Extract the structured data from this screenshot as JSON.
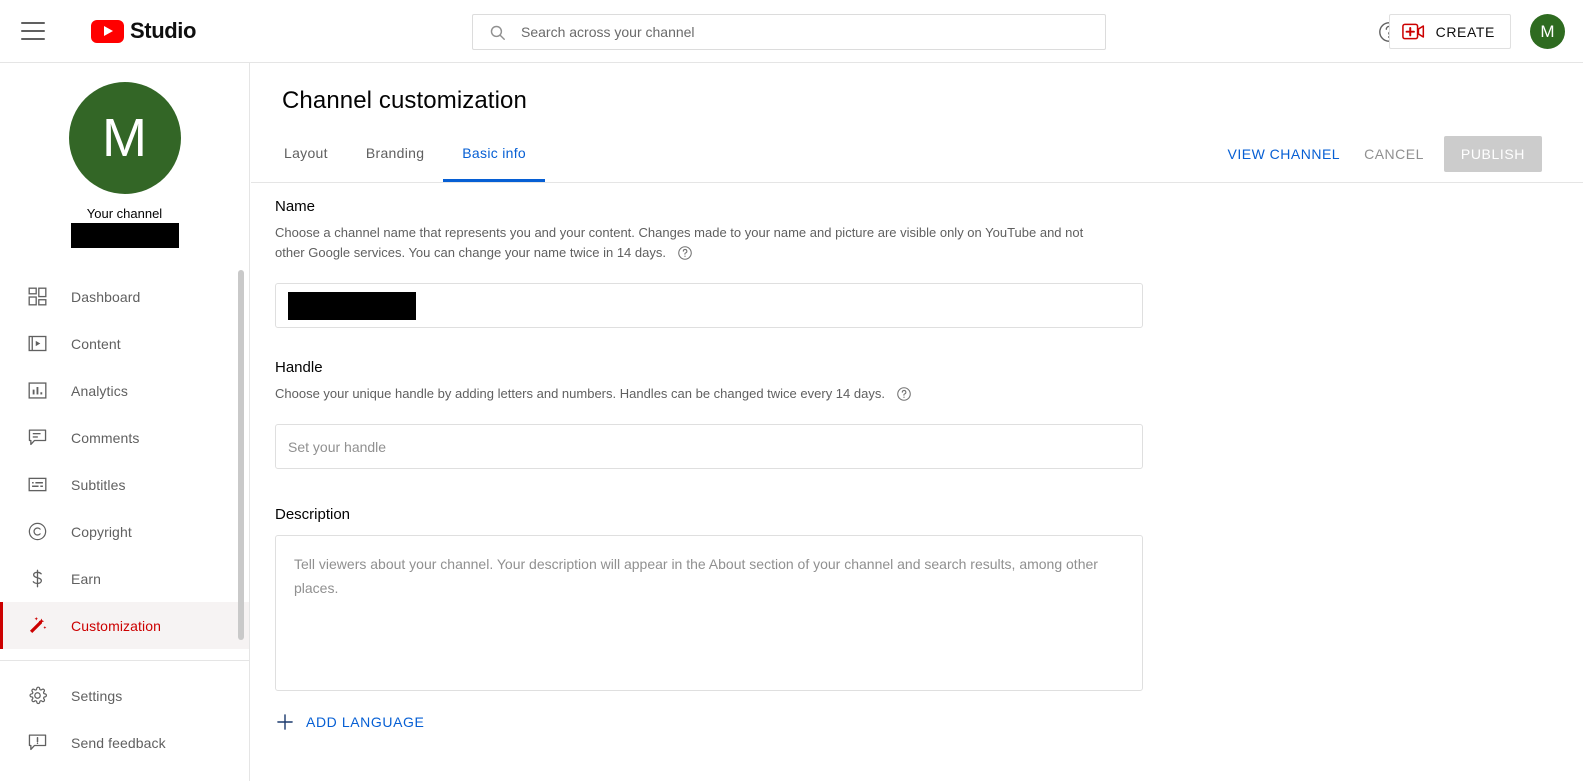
{
  "header": {
    "menu_icon": "hamburger-menu-icon",
    "logo_text": "Studio",
    "search": {
      "icon": "search-icon",
      "placeholder": "Search across your channel",
      "value": ""
    },
    "help_icon": "help-circle-icon",
    "create": {
      "icon": "video-plus-icon",
      "label": "CREATE"
    },
    "account_avatar_initial": "M",
    "account_avatar_color": "#2e6b20"
  },
  "sidebar": {
    "channel": {
      "avatar_initial": "M",
      "avatar_color": "#336626",
      "your_channel_label": "Your channel",
      "channel_name_redacted": true
    },
    "items": [
      {
        "label": "Dashboard",
        "icon": "dashboard-grid-icon",
        "active": false
      },
      {
        "label": "Content",
        "icon": "content-play-icon",
        "active": false
      },
      {
        "label": "Analytics",
        "icon": "analytics-bar-icon",
        "active": false
      },
      {
        "label": "Comments",
        "icon": "comment-bubble-icon",
        "active": false
      },
      {
        "label": "Subtitles",
        "icon": "subtitles-icon",
        "active": false
      },
      {
        "label": "Copyright",
        "icon": "copyright-icon",
        "active": false
      },
      {
        "label": "Earn",
        "icon": "dollar-sign-icon",
        "active": false
      },
      {
        "label": "Customization",
        "icon": "magic-wand-icon",
        "active": true
      }
    ],
    "footer_items": [
      {
        "label": "Settings",
        "icon": "gear-icon"
      },
      {
        "label": "Send feedback",
        "icon": "feedback-icon"
      }
    ],
    "active_color": "#cc0000"
  },
  "main": {
    "page_title": "Channel customization",
    "tabs": [
      {
        "label": "Layout",
        "active": false
      },
      {
        "label": "Branding",
        "active": false
      },
      {
        "label": "Basic info",
        "active": true
      }
    ],
    "active_tab_color": "#065fd4",
    "actions": {
      "view_channel": "VIEW CHANNEL",
      "cancel": "CANCEL",
      "publish": "PUBLISH",
      "publish_disabled": true
    },
    "fields": {
      "name": {
        "label": "Name",
        "help": "Choose a channel name that represents you and your content. Changes made to your name and picture are visible only on YouTube and not other Google services. You can change your name twice in 14 days.",
        "help_icon": "help-circle-icon",
        "value_redacted": true,
        "value": ""
      },
      "handle": {
        "label": "Handle",
        "help": "Choose your unique handle by adding letters and numbers. Handles can be changed twice every 14 days.",
        "help_icon": "help-circle-icon",
        "placeholder": "Set your handle",
        "value": ""
      },
      "description": {
        "label": "Description",
        "placeholder": "Tell viewers about your channel. Your description will appear in the About section of your channel and search results, among other places.",
        "value": ""
      }
    },
    "add_language": {
      "icon": "plus-icon",
      "label": "ADD LANGUAGE"
    }
  }
}
